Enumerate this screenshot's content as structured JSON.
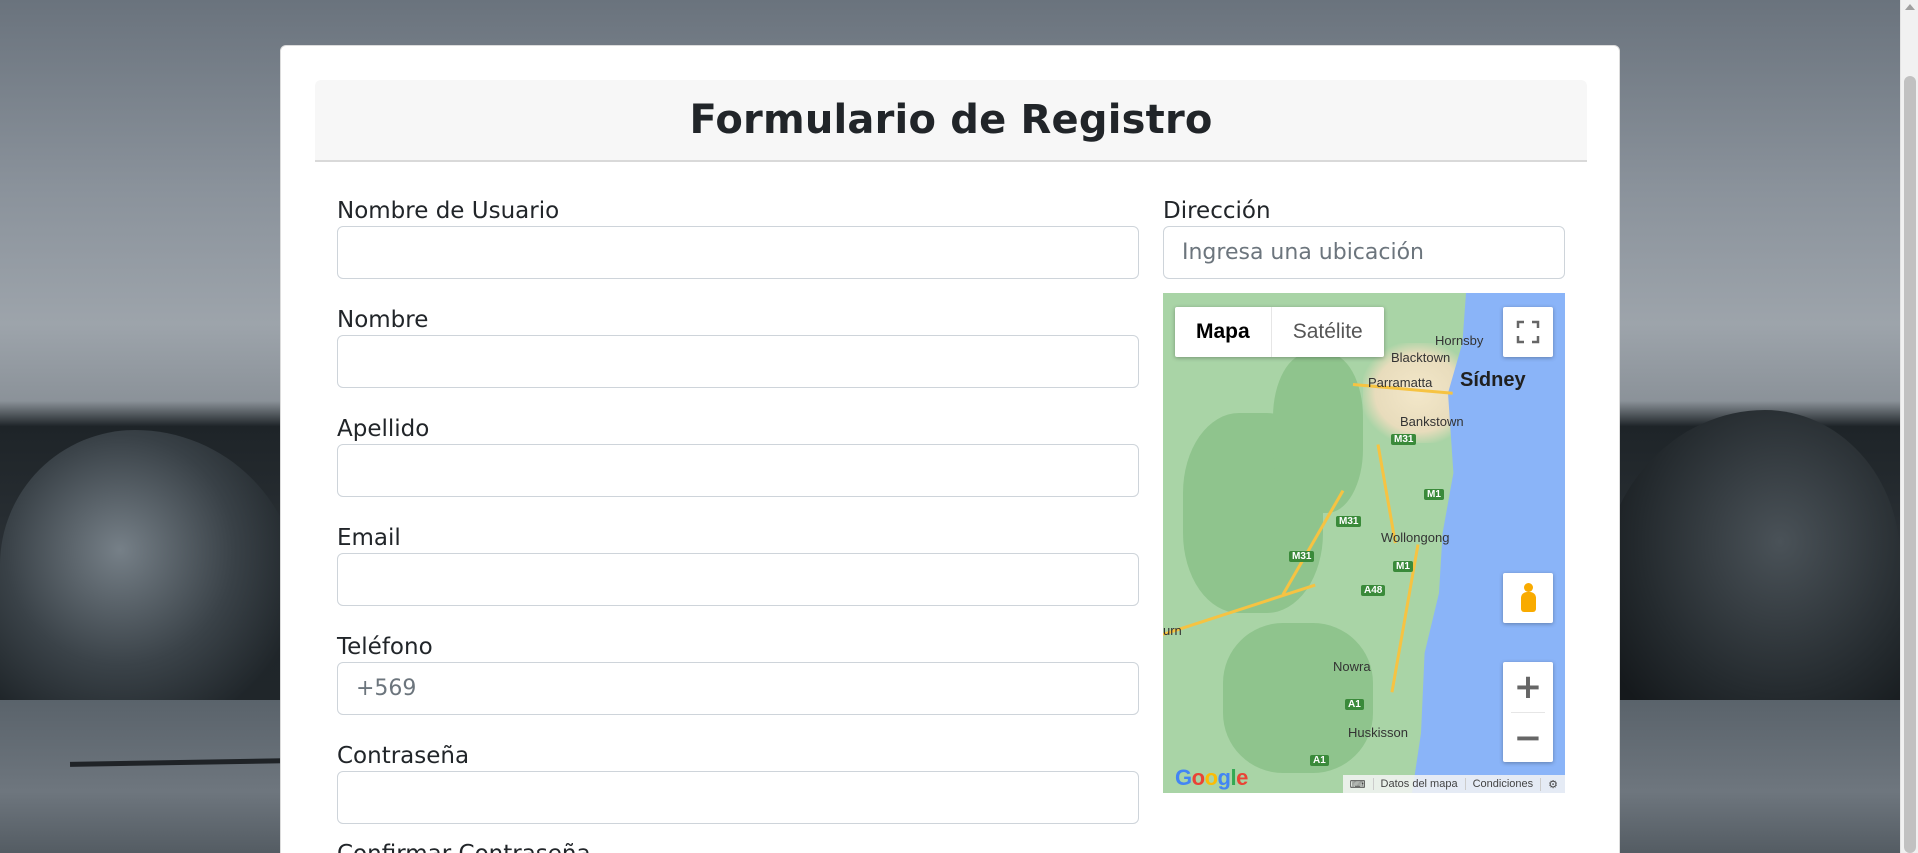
{
  "form": {
    "title": "Formulario de Registro",
    "fields": {
      "username": {
        "label": "Nombre de Usuario",
        "value": "",
        "placeholder": ""
      },
      "first_name": {
        "label": "Nombre",
        "value": "",
        "placeholder": ""
      },
      "last_name": {
        "label": "Apellido",
        "value": "",
        "placeholder": ""
      },
      "email": {
        "label": "Email",
        "value": "",
        "placeholder": ""
      },
      "phone": {
        "label": "Teléfono",
        "value": "",
        "placeholder": "+569"
      },
      "password": {
        "label": "Contraseña",
        "value": "",
        "placeholder": ""
      },
      "confirm_password": {
        "label": "Confirmar Contraseña"
      },
      "address": {
        "label": "Dirección",
        "value": "",
        "placeholder": "Ingresa una ubicación"
      }
    }
  },
  "map": {
    "type_buttons": {
      "map": "Mapa",
      "satellite": "Satélite"
    },
    "active_type": "Mapa",
    "labels": {
      "hornsby": "Hornsby",
      "blacktown": "Blacktown",
      "parramatta": "Parramatta",
      "sydney": "Sídney",
      "bankstown": "Bankstown",
      "wollongong": "Wollongong",
      "nowra": "Nowra",
      "huskisson": "Huskisson",
      "urn": "urn"
    },
    "road_shields": [
      "M31",
      "M1",
      "M31",
      "M31",
      "M1",
      "A48",
      "A1",
      "A1"
    ],
    "zoom_in": "+",
    "zoom_out": "−",
    "logo": "Google",
    "attribution": {
      "data": "Datos del mapa",
      "terms": "Condiciones"
    },
    "colors": {
      "land": "#a9d4a6",
      "water": "#8ab4f8",
      "roads": "#f6c342",
      "pegman": "#f9ab00"
    }
  }
}
